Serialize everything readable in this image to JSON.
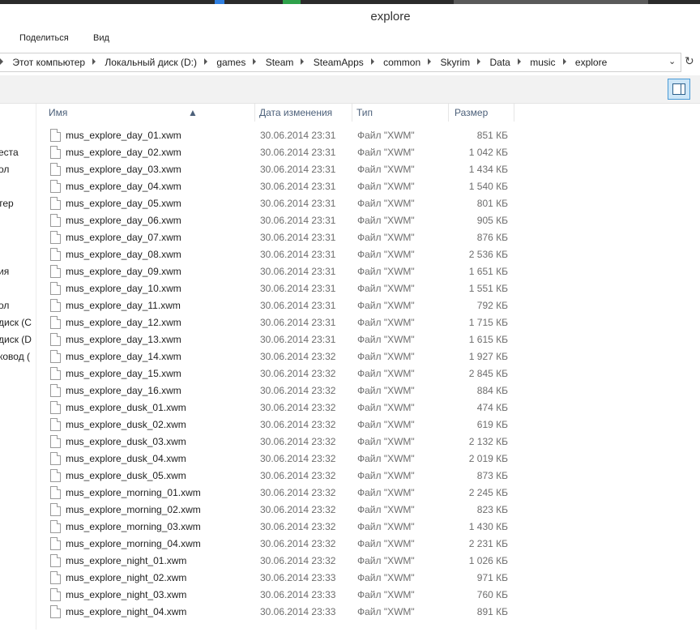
{
  "window": {
    "title": "explore"
  },
  "ribbon": {
    "share_label": "Поделиться",
    "view_label": "Вид"
  },
  "address": {
    "crumbs": [
      "Этот компьютер",
      "Локальный диск (D:)",
      "games",
      "Steam",
      "SteamApps",
      "common",
      "Skyrim",
      "Data",
      "music",
      "explore"
    ]
  },
  "nav": {
    "items": [
      "еста",
      "ол",
      "тер",
      "ия",
      "ол",
      "диск (C",
      "диск (D",
      "ковод ("
    ]
  },
  "columns": {
    "name": "Имя",
    "date": "Дата изменения",
    "type": "Тип",
    "size": "Размер"
  },
  "files": [
    {
      "name": "mus_explore_day_01.xwm",
      "date": "30.06.2014 23:31",
      "type": "Файл \"XWM\"",
      "size": "851 КБ"
    },
    {
      "name": "mus_explore_day_02.xwm",
      "date": "30.06.2014 23:31",
      "type": "Файл \"XWM\"",
      "size": "1 042 КБ"
    },
    {
      "name": "mus_explore_day_03.xwm",
      "date": "30.06.2014 23:31",
      "type": "Файл \"XWM\"",
      "size": "1 434 КБ"
    },
    {
      "name": "mus_explore_day_04.xwm",
      "date": "30.06.2014 23:31",
      "type": "Файл \"XWM\"",
      "size": "1 540 КБ"
    },
    {
      "name": "mus_explore_day_05.xwm",
      "date": "30.06.2014 23:31",
      "type": "Файл \"XWM\"",
      "size": "801 КБ"
    },
    {
      "name": "mus_explore_day_06.xwm",
      "date": "30.06.2014 23:31",
      "type": "Файл \"XWM\"",
      "size": "905 КБ"
    },
    {
      "name": "mus_explore_day_07.xwm",
      "date": "30.06.2014 23:31",
      "type": "Файл \"XWM\"",
      "size": "876 КБ"
    },
    {
      "name": "mus_explore_day_08.xwm",
      "date": "30.06.2014 23:31",
      "type": "Файл \"XWM\"",
      "size": "2 536 КБ"
    },
    {
      "name": "mus_explore_day_09.xwm",
      "date": "30.06.2014 23:31",
      "type": "Файл \"XWM\"",
      "size": "1 651 КБ"
    },
    {
      "name": "mus_explore_day_10.xwm",
      "date": "30.06.2014 23:31",
      "type": "Файл \"XWM\"",
      "size": "1 551 КБ"
    },
    {
      "name": "mus_explore_day_11.xwm",
      "date": "30.06.2014 23:31",
      "type": "Файл \"XWM\"",
      "size": "792 КБ"
    },
    {
      "name": "mus_explore_day_12.xwm",
      "date": "30.06.2014 23:31",
      "type": "Файл \"XWM\"",
      "size": "1 715 КБ"
    },
    {
      "name": "mus_explore_day_13.xwm",
      "date": "30.06.2014 23:31",
      "type": "Файл \"XWM\"",
      "size": "1 615 КБ"
    },
    {
      "name": "mus_explore_day_14.xwm",
      "date": "30.06.2014 23:32",
      "type": "Файл \"XWM\"",
      "size": "1 927 КБ"
    },
    {
      "name": "mus_explore_day_15.xwm",
      "date": "30.06.2014 23:32",
      "type": "Файл \"XWM\"",
      "size": "2 845 КБ"
    },
    {
      "name": "mus_explore_day_16.xwm",
      "date": "30.06.2014 23:32",
      "type": "Файл \"XWM\"",
      "size": "884 КБ"
    },
    {
      "name": "mus_explore_dusk_01.xwm",
      "date": "30.06.2014 23:32",
      "type": "Файл \"XWM\"",
      "size": "474 КБ"
    },
    {
      "name": "mus_explore_dusk_02.xwm",
      "date": "30.06.2014 23:32",
      "type": "Файл \"XWM\"",
      "size": "619 КБ"
    },
    {
      "name": "mus_explore_dusk_03.xwm",
      "date": "30.06.2014 23:32",
      "type": "Файл \"XWM\"",
      "size": "2 132 КБ"
    },
    {
      "name": "mus_explore_dusk_04.xwm",
      "date": "30.06.2014 23:32",
      "type": "Файл \"XWM\"",
      "size": "2 019 КБ"
    },
    {
      "name": "mus_explore_dusk_05.xwm",
      "date": "30.06.2014 23:32",
      "type": "Файл \"XWM\"",
      "size": "873 КБ"
    },
    {
      "name": "mus_explore_morning_01.xwm",
      "date": "30.06.2014 23:32",
      "type": "Файл \"XWM\"",
      "size": "2 245 КБ"
    },
    {
      "name": "mus_explore_morning_02.xwm",
      "date": "30.06.2014 23:32",
      "type": "Файл \"XWM\"",
      "size": "823 КБ"
    },
    {
      "name": "mus_explore_morning_03.xwm",
      "date": "30.06.2014 23:32",
      "type": "Файл \"XWM\"",
      "size": "1 430 КБ"
    },
    {
      "name": "mus_explore_morning_04.xwm",
      "date": "30.06.2014 23:32",
      "type": "Файл \"XWM\"",
      "size": "2 231 КБ"
    },
    {
      "name": "mus_explore_night_01.xwm",
      "date": "30.06.2014 23:32",
      "type": "Файл \"XWM\"",
      "size": "1 026 КБ"
    },
    {
      "name": "mus_explore_night_02.xwm",
      "date": "30.06.2014 23:33",
      "type": "Файл \"XWM\"",
      "size": "971 КБ"
    },
    {
      "name": "mus_explore_night_03.xwm",
      "date": "30.06.2014 23:33",
      "type": "Файл \"XWM\"",
      "size": "760 КБ"
    },
    {
      "name": "mus_explore_night_04.xwm",
      "date": "30.06.2014 23:33",
      "type": "Файл \"XWM\"",
      "size": "891 КБ"
    }
  ],
  "colors": {
    "accent": "#4a9ad6",
    "header_text": "#4c607a",
    "muted_text": "#6d6d6d"
  }
}
